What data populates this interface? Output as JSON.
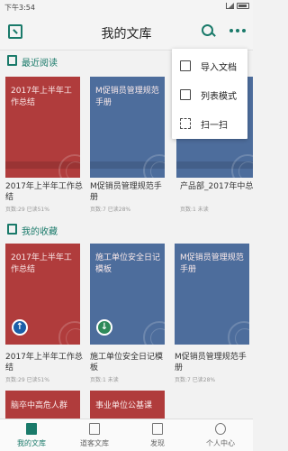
{
  "status_bar": {
    "time": "下午3:54"
  },
  "header": {
    "title": "我的文库"
  },
  "sections": {
    "recent": {
      "title": "最近阅读"
    },
    "favorites": {
      "title": "我的收藏"
    }
  },
  "recent_books": [
    {
      "cover_title": "2017年上半年工作总结",
      "name": "2017年上半年工作总结",
      "meta": "页数:29 已读51%",
      "color": "#b03c3c"
    },
    {
      "cover_title": "M促销员管理规范手册",
      "name": "M促销员管理规范手册",
      "meta": "页数:7 已读28%",
      "color": "#4d6d9c"
    },
    {
      "cover_title": "",
      "name": "产品部_2017年中总结",
      "meta": "页数:1 未读",
      "color": "#4d6d9c"
    }
  ],
  "favorite_books": [
    {
      "cover_title": "2017年上半年工作总结",
      "name": "2017年上半年工作总结",
      "meta": "页数:29 已读51%",
      "color": "#b03c3c",
      "action_icon": "upload-icon"
    },
    {
      "cover_title": "施工单位安全日记模板",
      "name": "施工单位安全日记模板",
      "meta": "页数:1 未读",
      "color": "#4d6d9c",
      "action_icon": "download-icon"
    },
    {
      "cover_title": "M促销员管理规范手册",
      "name": "M促销员管理规范手册",
      "meta": "页数:7 已读28%",
      "color": "#4d6d9c",
      "action_icon": ""
    }
  ],
  "partial_books": [
    {
      "cover_title": "脑卒中高危人群"
    },
    {
      "cover_title": "事业单位公基课"
    }
  ],
  "menu": {
    "items": [
      {
        "label": "导入文档",
        "icon": "import-icon"
      },
      {
        "label": "列表模式",
        "icon": "list-mode-icon"
      },
      {
        "label": "扫一扫",
        "icon": "scan-icon"
      }
    ]
  },
  "tabbar": {
    "tabs": [
      {
        "label": "我的文库",
        "icon": "library-icon",
        "active": true
      },
      {
        "label": "道客文库",
        "icon": "doc-store-icon",
        "active": false
      },
      {
        "label": "发现",
        "icon": "discover-icon",
        "active": false
      },
      {
        "label": "个人中心",
        "icon": "profile-icon",
        "active": false
      }
    ]
  },
  "colors": {
    "accent": "#1a7a6a",
    "cover_red": "#b03c3c",
    "cover_blue": "#4d6d9c"
  }
}
